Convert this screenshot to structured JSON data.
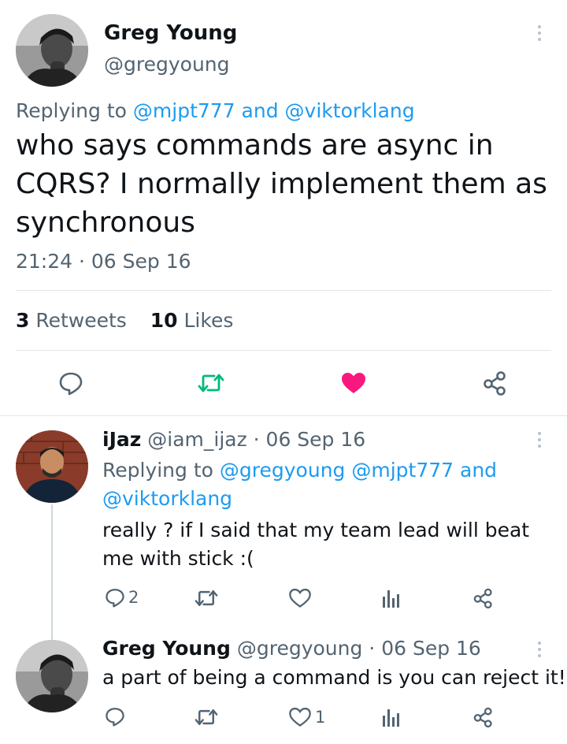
{
  "main_tweet": {
    "author_name": "Greg Young",
    "author_handle": "@gregyoung",
    "replying_prefix": "Replying to",
    "replying_to_1": "@mjpt777",
    "replying_and": "and",
    "replying_to_2": "@viktorklang",
    "text": "who says commands are async in CQRS? I normally implement them as synchronous",
    "timestamp": "21:24 · 06 Sep 16",
    "retweets_count": "3",
    "retweets_label": "Retweets",
    "likes_count": "10",
    "likes_label": "Likes"
  },
  "replies": [
    {
      "author_name": "iJaz",
      "author_handle": "@iam_ijaz",
      "date": "· 06 Sep 16",
      "replying_prefix": "Replying to",
      "replying_to_1": "@gregyoung",
      "replying_to_2": "@mjpt777",
      "replying_and": "and",
      "replying_to_3": "@viktorklang",
      "text": "really ? if I said that my team lead will beat me with stick :(",
      "reply_count": "2",
      "like_count": ""
    },
    {
      "author_name": "Greg Young",
      "author_handle": "@gregyoung",
      "date": "· 06 Sep 16",
      "text": "a part of being a command is you can reject it!",
      "reply_count": "",
      "like_count": "1"
    }
  ],
  "colors": {
    "retweet_green": "#00ba7c",
    "like_pink": "#f91880",
    "link_blue": "#1d9bf0",
    "muted_gray": "#536471"
  }
}
